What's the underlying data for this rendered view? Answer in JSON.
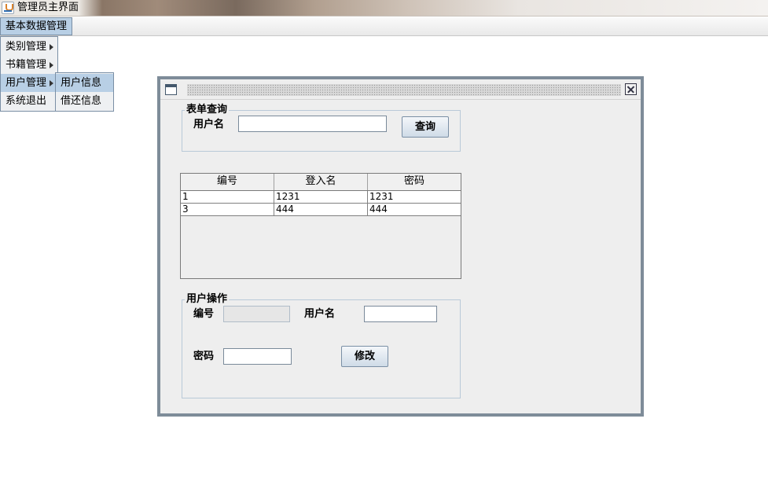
{
  "window": {
    "title": "管理员主界面"
  },
  "menubar": {
    "top_menu": "基本数据管理"
  },
  "dropdown": {
    "items": [
      {
        "label": "类别管理"
      },
      {
        "label": "书籍管理"
      },
      {
        "label": "用户管理"
      },
      {
        "label": "系统退出"
      }
    ]
  },
  "submenu": {
    "items": [
      {
        "label": "用户信息"
      },
      {
        "label": "借还信息"
      }
    ]
  },
  "query_form": {
    "legend": "表单查询",
    "username_label": "用户名",
    "username_value": "",
    "query_button": "查询"
  },
  "table": {
    "columns": [
      "编号",
      "登入名",
      "密码"
    ],
    "rows": [
      [
        "1",
        "1231",
        "1231"
      ],
      [
        "3",
        "444",
        "444"
      ]
    ]
  },
  "user_ops": {
    "legend": "用户操作",
    "id_label": "编号",
    "id_value": "",
    "username_label": "用户名",
    "username_value": "",
    "password_label": "密码",
    "password_value": "",
    "modify_button": "修改"
  },
  "colors": {
    "menu_highlight": "#b8cfe5",
    "frame_border": "#7e8c99",
    "panel_bg": "#eeeeee"
  }
}
